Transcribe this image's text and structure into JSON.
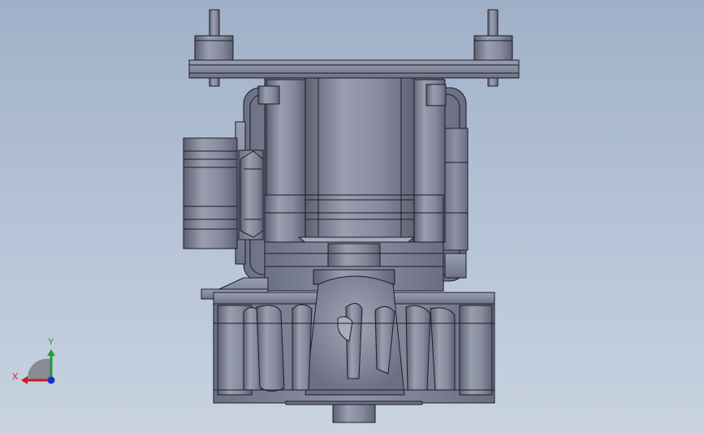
{
  "triad": {
    "x_label": "X",
    "y_label": "Y",
    "x_color": "#c81e1e",
    "y_color": "#1f9a3a",
    "z_color": "#1d2fc9"
  },
  "model": {
    "icon": "gearbox-assembly-icon",
    "body_color": "#7f8496",
    "highlight_color": "#9ca1b2",
    "edge_color": "#1b1d26"
  }
}
